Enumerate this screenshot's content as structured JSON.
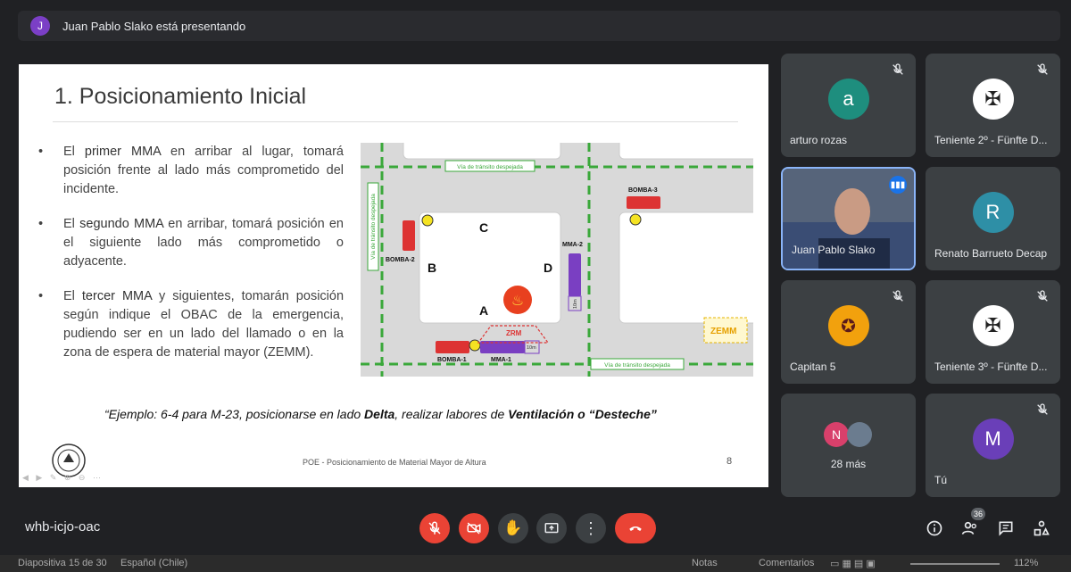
{
  "presenting": {
    "initial": "J",
    "text": "Juan Pablo Slako está presentando"
  },
  "slide": {
    "title": "1. Posicionamiento Inicial",
    "bullets": [
      {
        "pre": "El ",
        "bold": "primer MMA",
        "post": " en arribar al lugar, tomará posición frente al lado más comprometido del incidente."
      },
      {
        "pre": "El ",
        "bold": "segundo MMA",
        "post": " en arribar, tomará posición en el siguiente lado más comprometido o adyacente."
      },
      {
        "pre": "El ",
        "bold": "tercer MMA",
        "post": " y siguientes, tomarán posición según indique el OBAC de la emergencia, pudiendo ser en un lado del llamado o en la zona de espera de material mayor (ZEMM)."
      }
    ],
    "example": {
      "part1": "“Ejemplo: 6-4 para M-23, posicionarse en lado ",
      "bold1": "Delta",
      "part2": ", realizar labores de ",
      "bold2": "Ventilación o “Desteche”"
    },
    "footer": "POE - Posicionamiento de Material Mayor de Altura",
    "page": "8",
    "diagram": {
      "road_top": "Vía de tránsito despejada",
      "road_bottom": "Vía de tránsito despejada",
      "road_left": "Vía de tránsito despejada",
      "bomba1": "BOMBA-1",
      "bomba2": "BOMBA-2",
      "bomba3": "BOMBA-3",
      "mma1": "MMA-1",
      "mma2": "MMA-2",
      "zrm": "ZRM",
      "zemm": "ZEMM",
      "dist1": "10m",
      "dist2": "10m",
      "sideA": "A",
      "sideB": "B",
      "sideC": "C",
      "sideD": "D"
    }
  },
  "participants": [
    {
      "name": "arturo rozas",
      "initial": "a",
      "color": "#1e8e7e",
      "muted": true
    },
    {
      "name": "Teniente 2º - Fünfte D...",
      "icon": "eagle-crest-icon",
      "muted": true
    },
    {
      "name": "Juan Pablo Slako",
      "video": true,
      "speaking": true
    },
    {
      "name": "Renato Barrueto Decap",
      "initial": "R",
      "color": "#2e8fa6",
      "muted": false
    },
    {
      "name": "Capitan 5",
      "icon": "company-badge-icon",
      "muted": true
    },
    {
      "name": "Teniente 3º - Fünfte D...",
      "icon": "eagle-crest-icon",
      "muted": true
    },
    {
      "name": "28 más",
      "initials": [
        "N"
      ],
      "muted": false
    },
    {
      "name": "Tú",
      "initial": "M",
      "color": "#6a3fb8",
      "muted": true
    }
  ],
  "meeting_code": "whb-icjo-oac",
  "people_count": "36",
  "status_bar": {
    "slide_info": "Diapositiva 15 de 30",
    "language": "Español (Chile)",
    "notes": "Notas",
    "comments": "Comentarios",
    "zoom": "112%"
  },
  "colors": {
    "end_call": "#ea4335",
    "tile_bg": "#3c4043",
    "speaking_border": "#8ab4f8"
  }
}
